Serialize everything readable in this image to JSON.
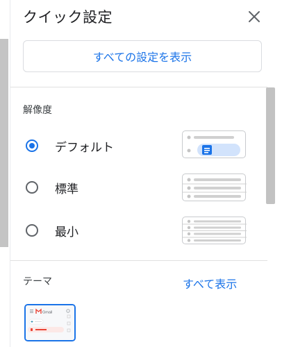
{
  "header": {
    "title": "クイック設定",
    "close_icon": "close-icon"
  },
  "all_settings_button": {
    "label": "すべての設定を表示"
  },
  "density": {
    "label": "解像度",
    "options": [
      {
        "label": "デフォルト",
        "selected": true
      },
      {
        "label": "標準",
        "selected": false
      },
      {
        "label": "最小",
        "selected": false
      }
    ]
  },
  "theme": {
    "label": "テーマ",
    "see_all": "すべて表示",
    "thumbnail_text": "Gmail"
  },
  "colors": {
    "accent": "#1a73e8",
    "text": "#202124",
    "divider": "#e0e0e0"
  }
}
